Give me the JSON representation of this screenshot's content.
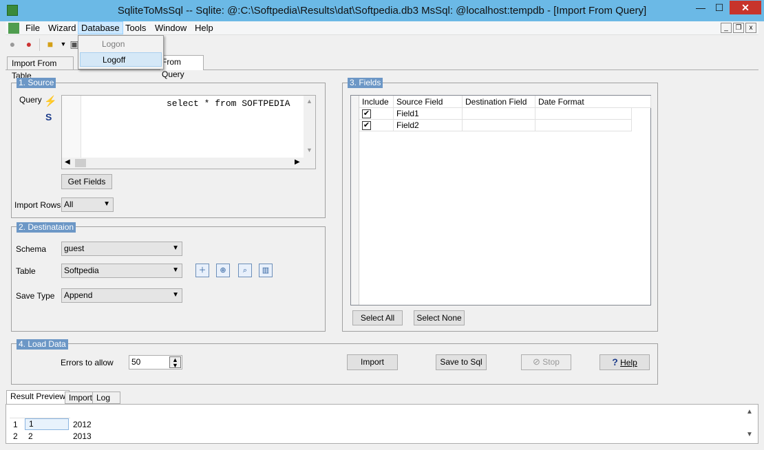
{
  "window": {
    "title": "SqliteToMsSql -- Sqlite: @:C:\\Softpedia\\Results\\dat\\Softpedia.db3 MsSql: @localhost:tempdb - [Import From Query]",
    "min": "—",
    "max": "☐",
    "close": "✕"
  },
  "menu": [
    "File",
    "Wizard",
    "Database",
    "Tools",
    "Window",
    "Help"
  ],
  "mdi": {
    "min": "_",
    "restore": "❐",
    "close": "x"
  },
  "database_menu": {
    "logon": "Logon",
    "logoff": "Logoff"
  },
  "tabs": {
    "import_table": "Import From Table",
    "import_query": "From Query"
  },
  "source": {
    "title": "1. Source",
    "query_label": "Query",
    "query_text": "select * from SOFTPEDIA",
    "get_fields": "Get Fields",
    "import_rows_label": "Import Rows",
    "import_rows_value": "All"
  },
  "destination": {
    "title": "2. Destinataion",
    "schema_label": "Schema",
    "schema_value": "guest",
    "table_label": "Table",
    "table_value": "Softpedia",
    "save_type_label": "Save Type",
    "save_type_value": "Append"
  },
  "fields": {
    "title": "3. Fields",
    "columns": [
      "Include",
      "Source Field",
      "Destination Field",
      "Date Format"
    ],
    "rows": [
      {
        "include": true,
        "source": "Field1",
        "destination": "",
        "date_format": ""
      },
      {
        "include": true,
        "source": "Field2",
        "destination": "",
        "date_format": ""
      }
    ],
    "select_all": "Select All",
    "select_none": "Select None"
  },
  "load": {
    "title": "4. Load Data",
    "errors_label": "Errors to allow",
    "errors_value": "50",
    "import": "Import",
    "save_to_sql": "Save to Sql",
    "stop": "Stop",
    "help": "Help"
  },
  "bottom_tabs": [
    "Result Preview",
    "Import",
    "Log"
  ],
  "results": [
    {
      "row": "1",
      "a": "1",
      "b": "2012"
    },
    {
      "row": "2",
      "a": "2",
      "b": "2013"
    }
  ]
}
